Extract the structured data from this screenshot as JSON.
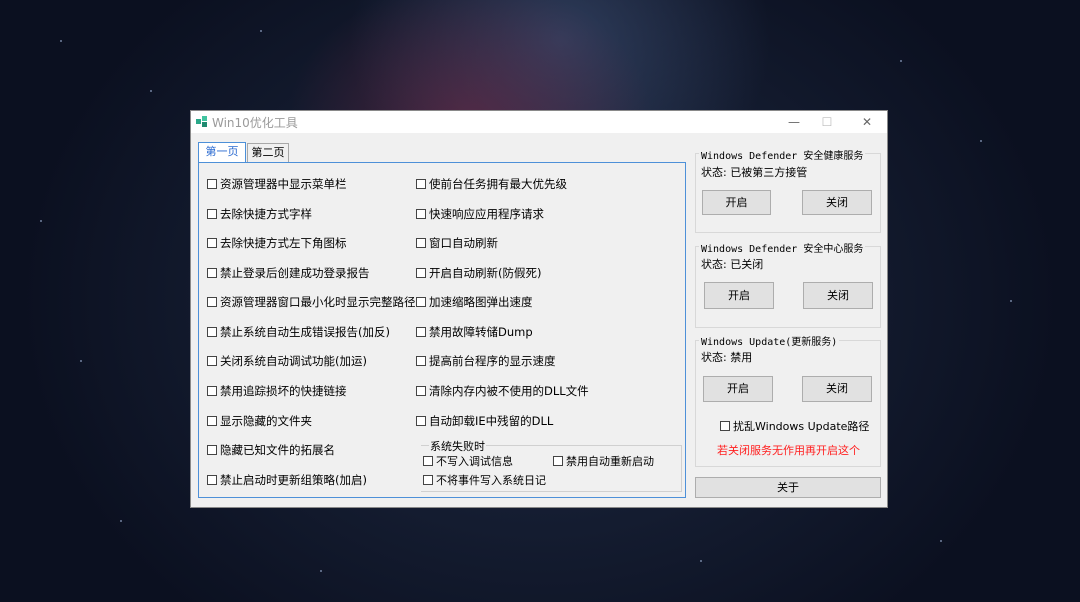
{
  "window": {
    "title": "Win10优化工具",
    "minimize": "—",
    "maximize": "☐",
    "close": "✕"
  },
  "tabs": [
    "第一页",
    "第二页"
  ],
  "left_column": [
    "资源管理器中显示菜单栏",
    "去除快捷方式字样",
    "去除快捷方式左下角图标",
    "禁止登录后创建成功登录报告",
    "资源管理器窗口最小化时显示完整路径",
    "禁止系统自动生成错误报告(加反)",
    "关闭系统自动调试功能(加运)",
    "禁用追踪损坏的快捷链接",
    "显示隐藏的文件夹",
    "隐藏已知文件的拓展名",
    "禁止启动时更新组策略(加启)"
  ],
  "right_column": [
    "使前台任务拥有最大优先级",
    "快速响应应用程序请求",
    "窗口自动刷新",
    "开启自动刷新(防假死)",
    "加速缩略图弹出速度",
    "禁用故障转储Dump",
    "提高前台程序的显示速度",
    "清除内存内被不使用的DLL文件",
    "自动卸载IE中残留的DLL"
  ],
  "system_failure": {
    "title": "系统失败时",
    "opt1": "不写入调试信息",
    "opt2": "禁用自动重新启动",
    "opt3": "不将事件写入系统日记"
  },
  "defender_health": {
    "title": "Windows Defender 安全健康服务",
    "status": "状态: 已被第三方接管",
    "on": "开启",
    "off": "关闭"
  },
  "defender_center": {
    "title": "Windows Defender 安全中心服务",
    "status": "状态: 已关闭",
    "on": "开启",
    "off": "关闭"
  },
  "windows_update": {
    "title": "Windows Update(更新服务)",
    "status": "状态: 禁用",
    "on": "开启",
    "off": "关闭",
    "scramble": "扰乱Windows Update路径",
    "warning": "若关闭服务无作用再开启这个"
  },
  "about": "关于",
  "colors": {
    "accent": "#4d90d8",
    "warning": "#ff1e1e"
  },
  "icons": [
    "app-icon",
    "minimize-icon",
    "maximize-icon",
    "close-icon"
  ]
}
